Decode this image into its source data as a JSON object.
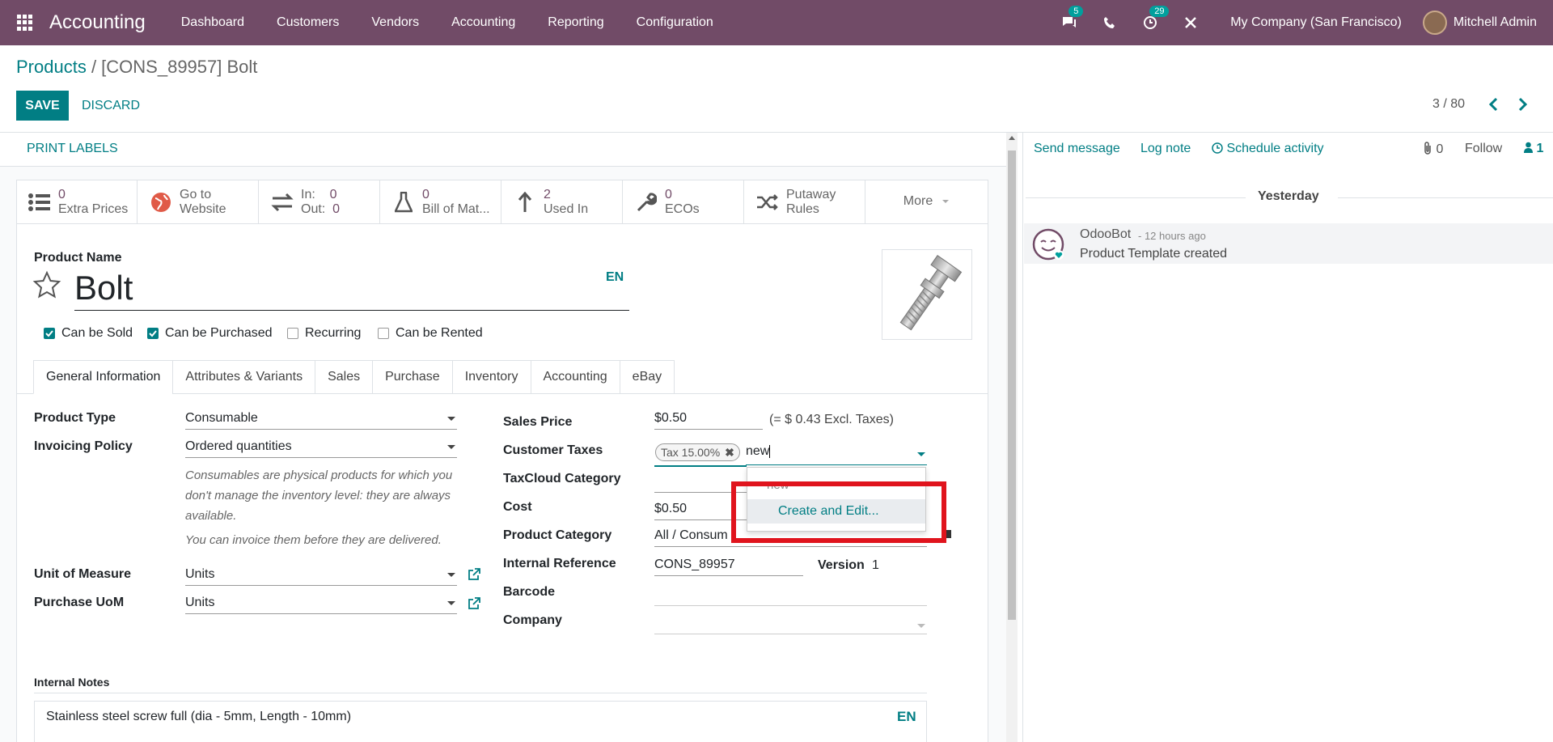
{
  "navbar": {
    "app_title": "Accounting",
    "menu": [
      "Dashboard",
      "Customers",
      "Vendors",
      "Accounting",
      "Reporting",
      "Configuration"
    ],
    "messages_count": "5",
    "activities_count": "29",
    "company": "My Company (San Francisco)",
    "user": "Mitchell Admin"
  },
  "control": {
    "breadcrumb_parent": "Products",
    "breadcrumb_sep": " / ",
    "breadcrumb_current": "[CONS_89957] Bolt",
    "save": "SAVE",
    "discard": "DISCARD",
    "pager": "3 / 80"
  },
  "statusbar": {
    "print_labels": "PRINT LABELS"
  },
  "smart_buttons": [
    {
      "num": "0",
      "label": "Extra Prices"
    },
    {
      "line1": "Go to",
      "line2": "Website"
    },
    {
      "in_label": "In:",
      "in_val": "0",
      "out_label": "Out:",
      "out_val": "0"
    },
    {
      "num": "0",
      "label": "Bill of Mat..."
    },
    {
      "num": "2",
      "label": "Used In"
    },
    {
      "num": "0",
      "label": "ECOs"
    },
    {
      "line1": "Putaway",
      "line2": "Rules"
    },
    {
      "label": "More"
    }
  ],
  "product": {
    "name_label": "Product Name",
    "name": "Bolt",
    "lang": "EN",
    "checkboxes": [
      {
        "label": "Can be Sold",
        "checked": true
      },
      {
        "label": "Can be Purchased",
        "checked": true
      },
      {
        "label": "Recurring",
        "checked": false
      },
      {
        "label": "Can be Rented",
        "checked": false
      }
    ]
  },
  "tabs": [
    "General Information",
    "Attributes & Variants",
    "Sales",
    "Purchase",
    "Inventory",
    "Accounting",
    "eBay"
  ],
  "fields_left": {
    "product_type_label": "Product Type",
    "product_type": "Consumable",
    "invoicing_policy_label": "Invoicing Policy",
    "invoicing_policy": "Ordered quantities",
    "help1": "Consumables are physical products for which you don't manage the inventory level: they are always available.",
    "help2": "You can invoice them before they are delivered.",
    "uom_label": "Unit of Measure",
    "uom": "Units",
    "purchase_uom_label": "Purchase UoM",
    "purchase_uom": "Units"
  },
  "fields_right": {
    "sales_price_label": "Sales Price",
    "sales_price": "$0.50",
    "excl_taxes": "(= $ 0.43 Excl. Taxes)",
    "customer_taxes_label": "Customer Taxes",
    "tax_tag": "Tax 15.00%",
    "tax_input": "new",
    "taxcloud_label": "TaxCloud Category",
    "cost_label": "Cost",
    "cost": "$0.50",
    "category_label": "Product Category",
    "category": "All / Consum",
    "internal_ref_label": "Internal Reference",
    "internal_ref": "CONS_89957",
    "version_label": "Version",
    "version": "1",
    "barcode_label": "Barcode",
    "company_label": "Company"
  },
  "dropdown": {
    "item_new": "new",
    "create_edit": "Create and Edit..."
  },
  "notes": {
    "label": "Internal Notes",
    "text": "Stainless steel screw full (dia - 5mm, Length - 10mm)",
    "lang": "EN"
  },
  "chatter": {
    "send_message": "Send message",
    "log_note": "Log note",
    "schedule_activity": "Schedule activity",
    "attachments": "0",
    "follow": "Follow",
    "followers": "1",
    "day": "Yesterday",
    "author": "OdooBot",
    "time": "- 12 hours ago",
    "body": "Product Template created"
  },
  "colors": {
    "brand": "#714B67",
    "accent": "#017e84",
    "highlight_box": "#e0141d"
  }
}
